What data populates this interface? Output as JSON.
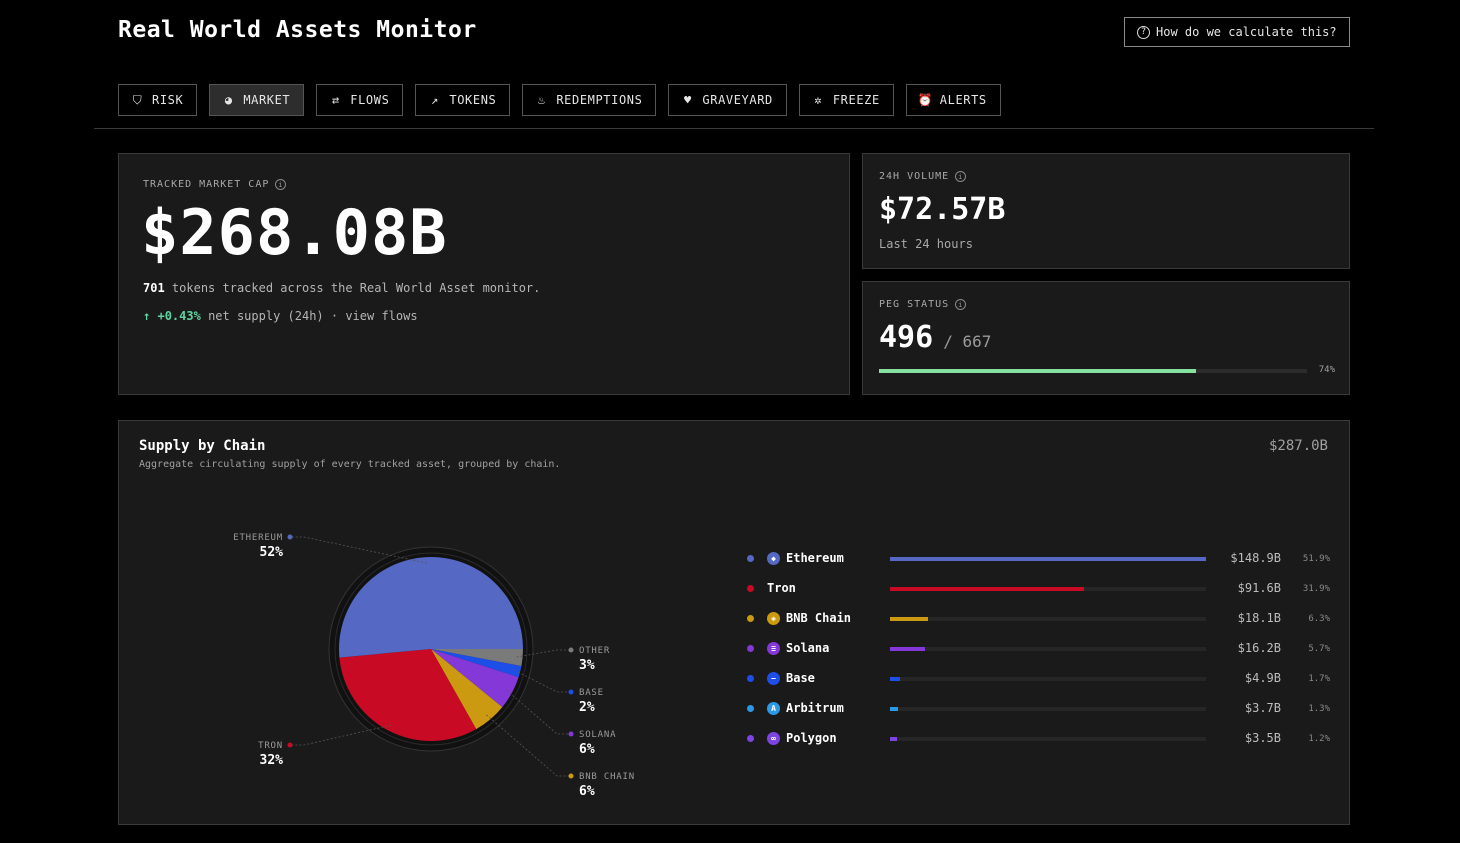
{
  "header": {
    "title": "Real World Assets Monitor",
    "help_label": "How do we calculate this?"
  },
  "tabs": [
    {
      "label": "RISK",
      "icon": "shield-icon"
    },
    {
      "label": "MARKET",
      "icon": "pie-chart-icon",
      "active": true
    },
    {
      "label": "FLOWS",
      "icon": "arrows-icon"
    },
    {
      "label": "TOKENS",
      "icon": "trend-icon"
    },
    {
      "label": "REDEMPTIONS",
      "icon": "flame-icon"
    },
    {
      "label": "GRAVEYARD",
      "icon": "broken-heart-icon"
    },
    {
      "label": "FREEZE",
      "icon": "snowflake-icon"
    },
    {
      "label": "ALERTS",
      "icon": "alarm-icon"
    }
  ],
  "market_cap": {
    "label": "TRACKED MARKET CAP",
    "value": "$268.08B",
    "token_count": "701",
    "desc": "tokens tracked across the Real World Asset monitor.",
    "supply_change": "+0.43%",
    "supply_text": "net supply (24h) · view flows"
  },
  "volume": {
    "label": "24H VOLUME",
    "value": "$72.57B",
    "sub": "Last 24 hours"
  },
  "peg": {
    "label": "PEG STATUS",
    "num": "496",
    "den": "/ 667",
    "pct_label": "74%",
    "fraction": 0.74
  },
  "chain": {
    "title": "Supply by Chain",
    "subtitle": "Aggregate circulating supply of every tracked asset, grouped by chain.",
    "total": "$287.0B"
  },
  "colors": {
    "ethereum": "#5468c4",
    "tron": "#c80a24",
    "bnb": "#cc9a10",
    "solana": "#8438d8",
    "base": "#1d4ee8",
    "arbitrum": "#2b9ae6",
    "polygon": "#7c44e0",
    "other": "#7a7a7a"
  },
  "chart_data": {
    "type": "pie",
    "title": "Supply by Chain",
    "slices": [
      {
        "name": "ETHEREUM",
        "pct": 52,
        "label": "52%"
      },
      {
        "name": "TRON",
        "pct": 32,
        "label": "32%"
      },
      {
        "name": "BNB CHAIN",
        "pct": 6,
        "label": "6%"
      },
      {
        "name": "SOLANA",
        "pct": 6,
        "label": "6%"
      },
      {
        "name": "BASE",
        "pct": 2,
        "label": "2%"
      },
      {
        "name": "OTHER",
        "pct": 3,
        "label": "3%"
      }
    ],
    "legend": [
      {
        "name": "Ethereum",
        "value": "$148.9B",
        "pct": "51.9%",
        "share": 51.9,
        "color": "#5468c4",
        "icon": "ethereum-icon"
      },
      {
        "name": "Tron",
        "value": "$91.6B",
        "pct": "31.9%",
        "share": 31.9,
        "color": "#c80a24",
        "icon": ""
      },
      {
        "name": "BNB Chain",
        "value": "$18.1B",
        "pct": "6.3%",
        "share": 6.3,
        "color": "#cc9a10",
        "icon": "bnb-icon"
      },
      {
        "name": "Solana",
        "value": "$16.2B",
        "pct": "5.7%",
        "share": 5.7,
        "color": "#8438d8",
        "icon": "solana-icon"
      },
      {
        "name": "Base",
        "value": "$4.9B",
        "pct": "1.7%",
        "share": 1.7,
        "color": "#1d4ee8",
        "icon": "base-icon"
      },
      {
        "name": "Arbitrum",
        "value": "$3.7B",
        "pct": "1.3%",
        "share": 1.3,
        "color": "#2b9ae6",
        "icon": "arbitrum-icon"
      },
      {
        "name": "Polygon",
        "value": "$3.5B",
        "pct": "1.2%",
        "share": 1.2,
        "color": "#7c44e0",
        "icon": "polygon-icon"
      }
    ]
  }
}
